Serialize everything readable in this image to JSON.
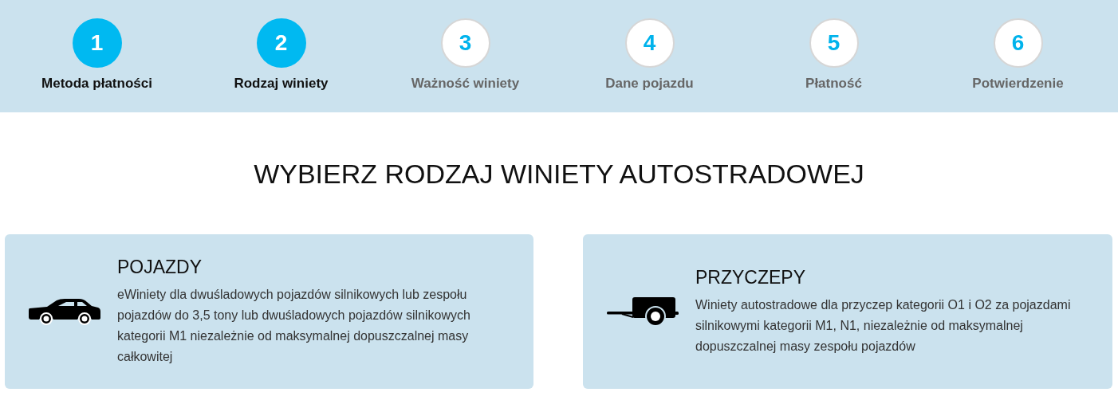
{
  "steps": [
    {
      "number": "1",
      "label": "Metoda płatności",
      "active": true
    },
    {
      "number": "2",
      "label": "Rodzaj winiety",
      "active": true
    },
    {
      "number": "3",
      "label": "Ważność winiety",
      "active": false
    },
    {
      "number": "4",
      "label": "Dane pojazdu",
      "active": false
    },
    {
      "number": "5",
      "label": "Płatność",
      "active": false
    },
    {
      "number": "6",
      "label": "Potwierdzenie",
      "active": false
    }
  ],
  "heading": "WYBIERZ RODZAJ WINIETY AUTOSTRADOWEJ",
  "options": [
    {
      "kind": "car",
      "title": "POJAZDY",
      "description": "eWiniety dla dwuśladowych pojazdów silnikowych lub zespołu pojazdów do 3,5 tony lub dwuśladowych pojazdów silnikowych kategorii M1 niezależnie od maksymalnej dopuszczalnej masy całkowitej"
    },
    {
      "kind": "trailer",
      "title": "PRZYCZEPY",
      "description": "Winiety autostradowe dla przyczep kategorii O1 i O2 za pojazdami silnikowymi kategorii M1, N1, niezależnie od maksymalnej dopuszczalnej masy zespołu pojazdów"
    }
  ]
}
